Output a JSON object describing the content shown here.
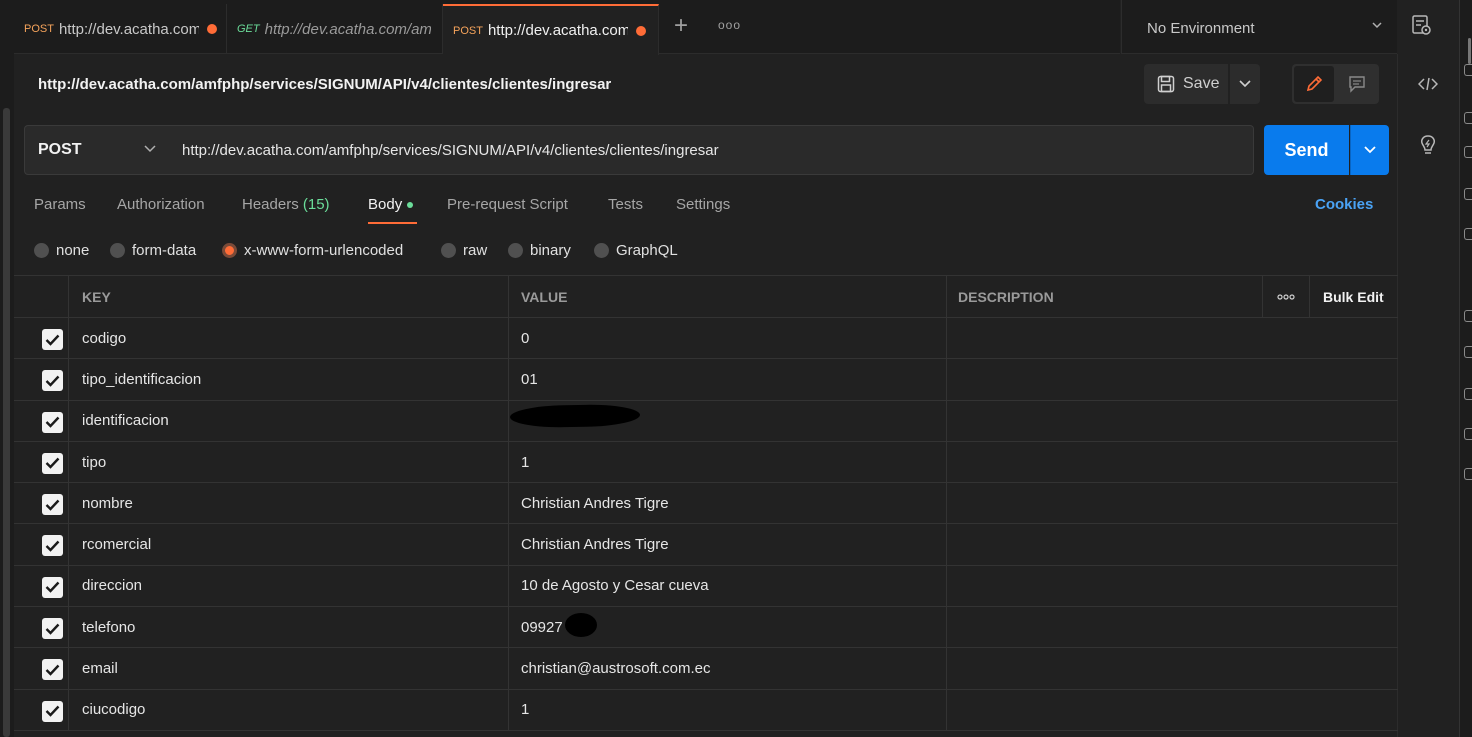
{
  "tabs": [
    {
      "method": "POST",
      "url": "http://dev.acatha.com",
      "unsaved": true,
      "active": false
    },
    {
      "method": "GET",
      "url": "http://dev.acatha.com/am",
      "unsaved": false,
      "active": false
    },
    {
      "method": "POST",
      "url": "http://dev.acatha.com",
      "unsaved": true,
      "active": true
    }
  ],
  "environment": {
    "label": "No Environment"
  },
  "request": {
    "title": "http://dev.acatha.com/amfphp/services/SIGNUM/API/v4/clientes/clientes/ingresar",
    "method": "POST",
    "url": "http://dev.acatha.com/amfphp/services/SIGNUM/API/v4/clientes/clientes/ingresar",
    "save_label": "Save",
    "send_label": "Send"
  },
  "subtabs": {
    "params": "Params",
    "authorization": "Authorization",
    "headers": "Headers",
    "headers_count": "(15)",
    "body": "Body",
    "prerequest": "Pre-request Script",
    "tests": "Tests",
    "settings": "Settings",
    "cookies": "Cookies"
  },
  "body_types": {
    "none": "none",
    "form_data": "form-data",
    "urlencoded": "x-www-form-urlencoded",
    "raw": "raw",
    "binary": "binary",
    "graphql": "GraphQL",
    "selected": "x-www-form-urlencoded"
  },
  "table": {
    "headers": {
      "key": "KEY",
      "value": "VALUE",
      "description": "DESCRIPTION",
      "bulk_edit": "Bulk Edit"
    },
    "rows": [
      {
        "key": "codigo",
        "value": "0",
        "checked": true
      },
      {
        "key": "tipo_identificacion",
        "value": "01",
        "checked": true
      },
      {
        "key": "identificacion",
        "value": "",
        "checked": true
      },
      {
        "key": "tipo",
        "value": "1",
        "checked": true
      },
      {
        "key": "nombre",
        "value": "Christian Andres Tigre",
        "checked": true
      },
      {
        "key": "rcomercial",
        "value": "Christian Andres Tigre",
        "checked": true
      },
      {
        "key": "direccion",
        "value": "10 de Agosto y Cesar cueva",
        "checked": true
      },
      {
        "key": "telefono",
        "value": "09927    99",
        "checked": true
      },
      {
        "key": "email",
        "value": "christian@austrosoft.com.ec",
        "checked": true
      },
      {
        "key": "ciucodigo",
        "value": "1",
        "checked": true
      }
    ]
  },
  "colors": {
    "accent": "#ff6c37",
    "send": "#097bed",
    "link": "#4aa3f5",
    "success": "#6bdd9a"
  }
}
